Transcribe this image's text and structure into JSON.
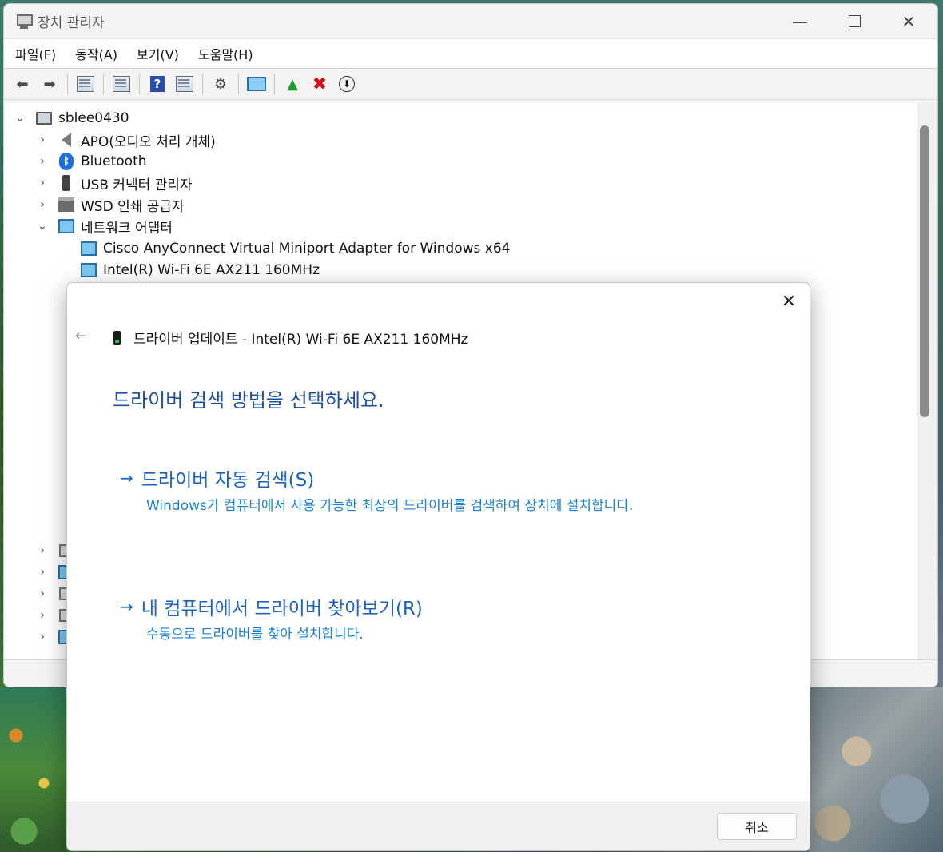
{
  "window": {
    "title": "장치 관리자",
    "controls": {
      "minimize": "—",
      "close": "✕"
    }
  },
  "menu": {
    "items": [
      "파일(F)",
      "동작(A)",
      "보기(V)",
      "도움말(H)"
    ]
  },
  "toolbar": {
    "icons": [
      "back-arrow-icon",
      "forward-arrow-icon",
      "properties-grid-icon",
      "properties-sheet-icon",
      "help-icon",
      "view-icon",
      "scan-hardware-icon",
      "monitor-icon",
      "update-driver-icon",
      "uninstall-x-icon",
      "download-circle-icon"
    ]
  },
  "tree": {
    "root": "sblee0430",
    "nodes": [
      {
        "label": "APO(오디오 처리 개체)",
        "state": "collapsed",
        "icon": "speaker-icon"
      },
      {
        "label": "Bluetooth",
        "state": "collapsed",
        "icon": "bluetooth-icon"
      },
      {
        "label": "USB 커넥터 관리자",
        "state": "collapsed",
        "icon": "usb-icon"
      },
      {
        "label": "WSD 인쇄 공급자",
        "state": "collapsed",
        "icon": "printer-icon"
      },
      {
        "label": "네트워크 어댑터",
        "state": "expanded",
        "icon": "network-icon"
      }
    ],
    "children": [
      {
        "label": "Cisco AnyConnect Virtual Miniport Adapter for Windows x64"
      },
      {
        "label": "Intel(R) Wi-Fi 6E AX211 160MHz"
      }
    ]
  },
  "dialog": {
    "close": "✕",
    "back": "←",
    "header": "드라이버 업데이트 - Intel(R) Wi-Fi 6E AX211 160MHz",
    "question": "드라이버 검색 방법을 선택하세요.",
    "option_auto": {
      "arrow": "→",
      "title": "드라이버 자동 검색(S)",
      "desc": "Windows가 컴퓨터에서 사용 가능한 최상의 드라이버를 검색하여 장치에 설치합니다."
    },
    "option_browse": {
      "arrow": "→",
      "title": "내 컴퓨터에서 드라이버 찾아보기(R)",
      "desc": "수동으로 드라이버를 찾아 설치합니다."
    },
    "cancel": "취소"
  }
}
